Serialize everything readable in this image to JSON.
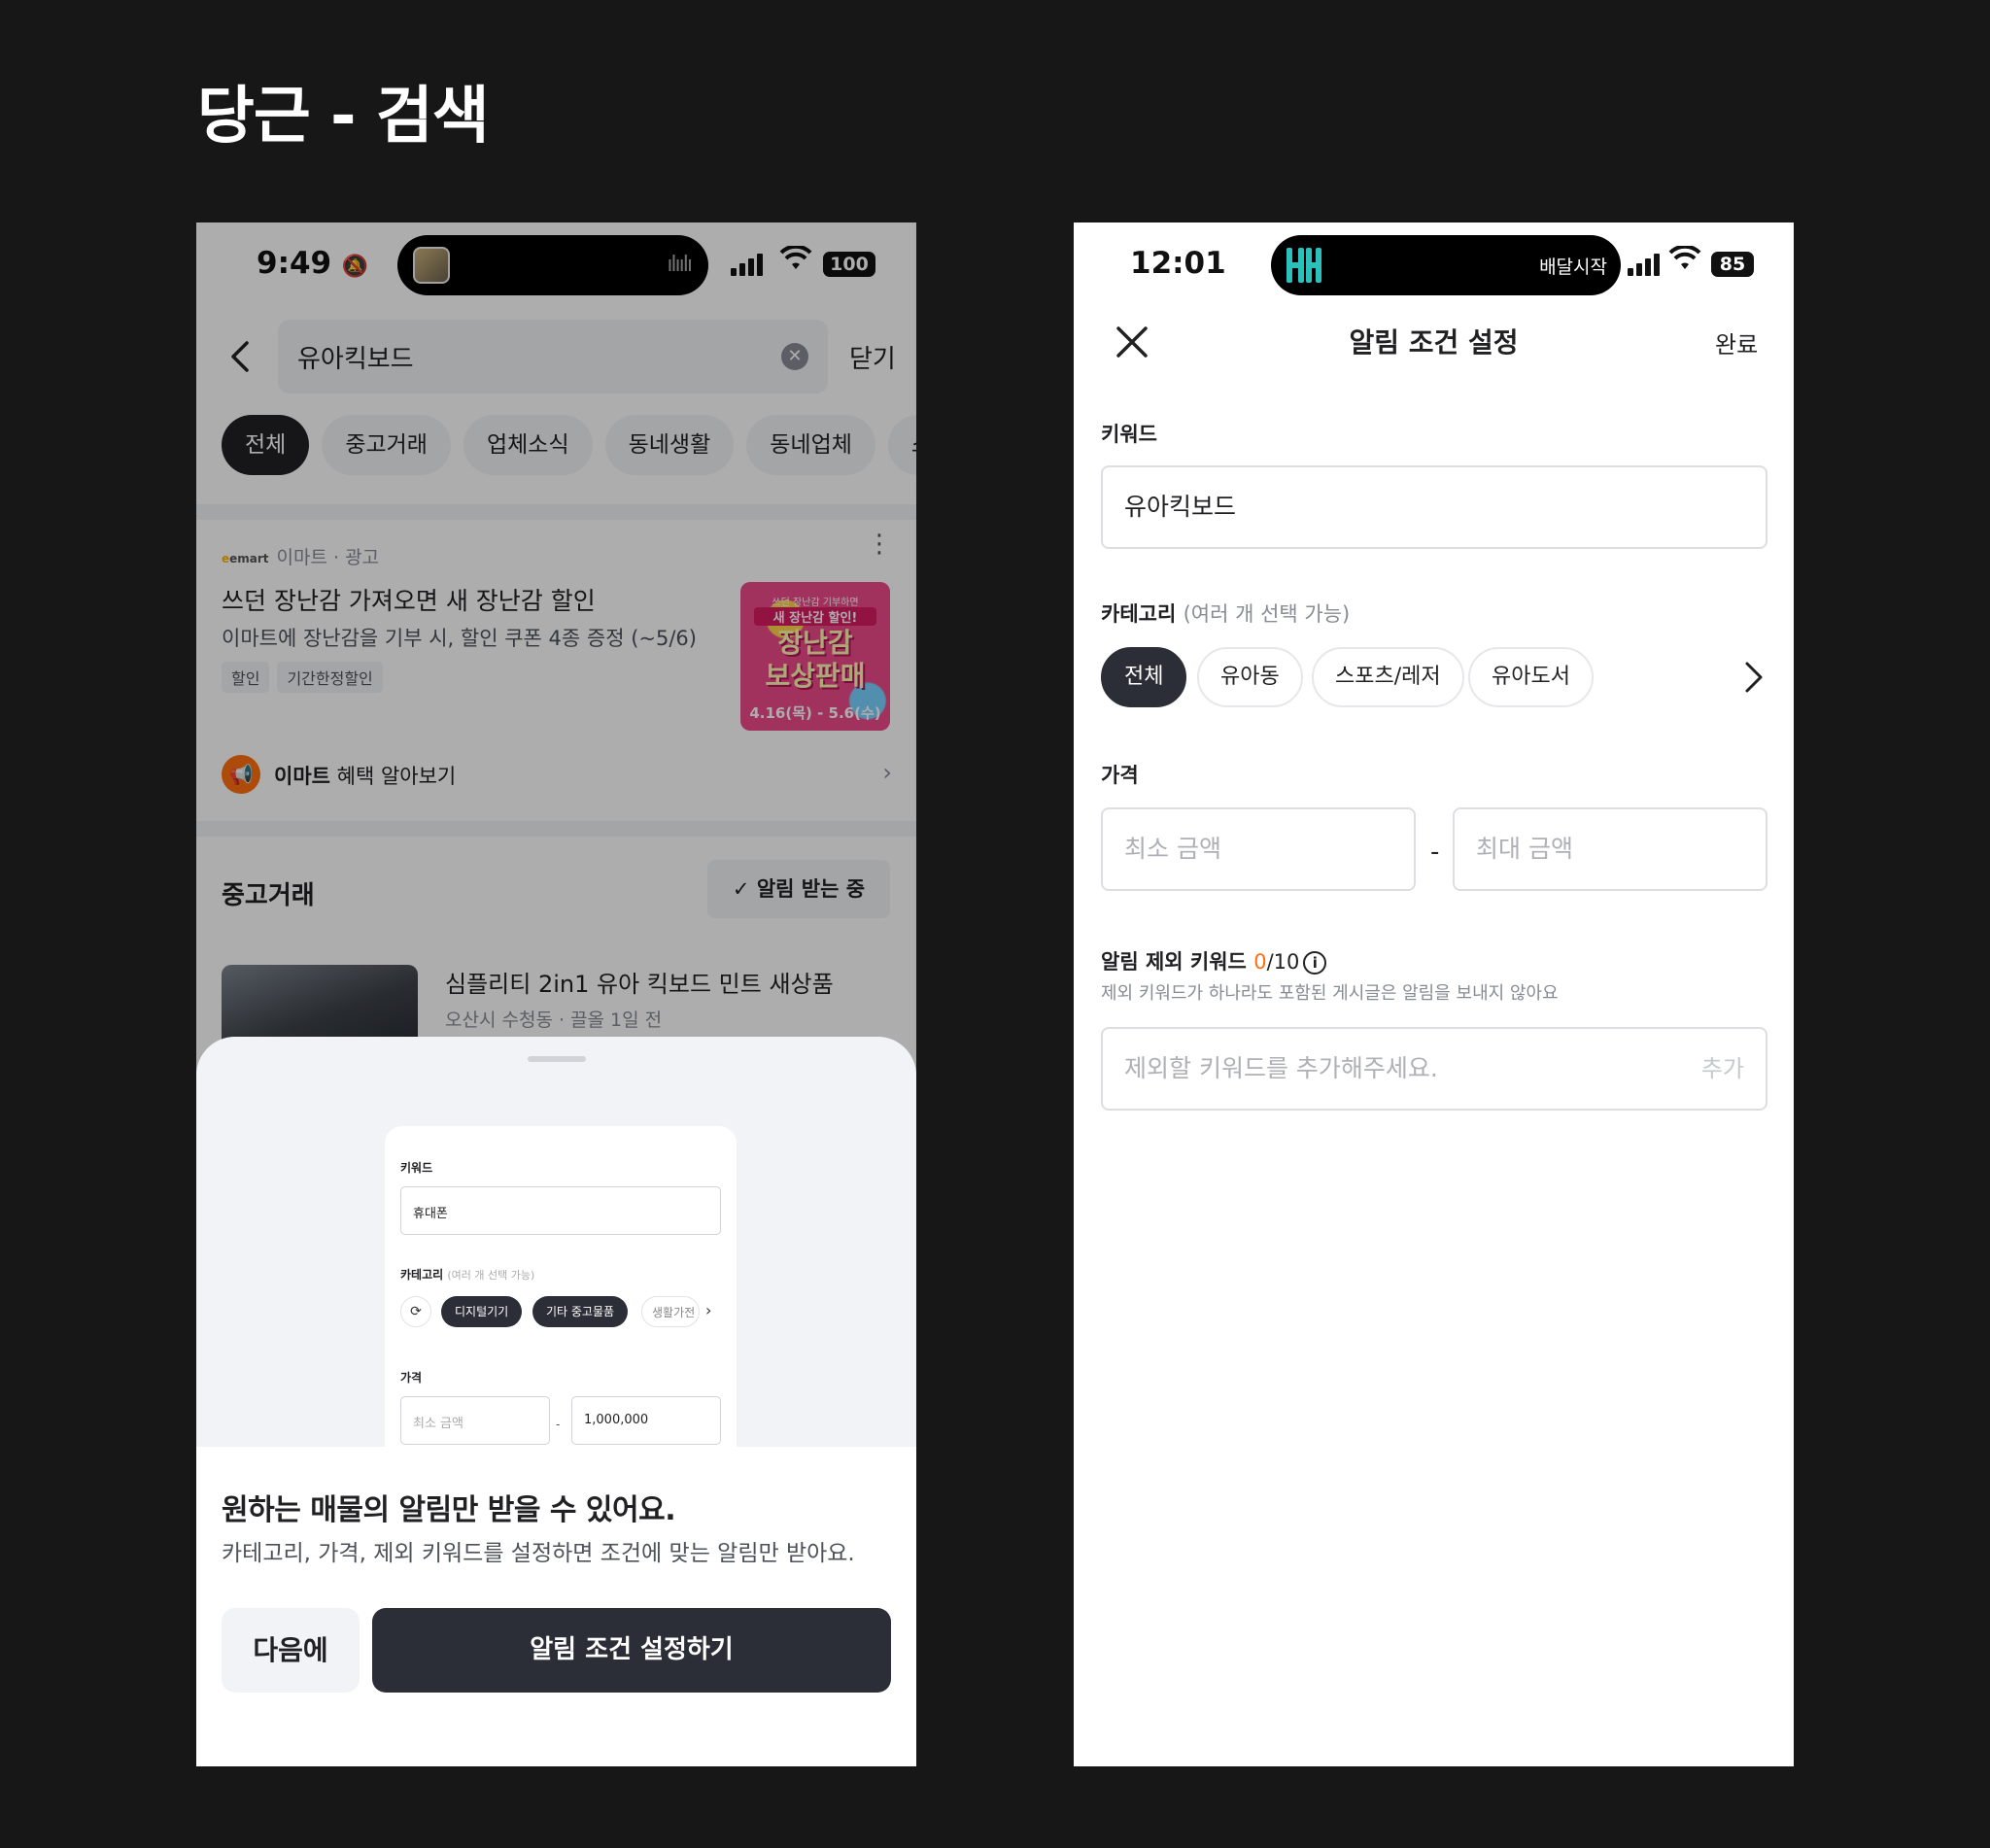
{
  "page_title": "당근 - 검색",
  "left_phone": {
    "status": {
      "time": "9:49",
      "bell_muted": "🔕",
      "battery": "100"
    },
    "search": {
      "query": "유아킥보드",
      "close_label": "닫기"
    },
    "tabs": [
      {
        "label": "전체",
        "active": true
      },
      {
        "label": "중고거래"
      },
      {
        "label": "업체소식"
      },
      {
        "label": "동네생활"
      },
      {
        "label": "동네업체"
      },
      {
        "label": "스토"
      }
    ],
    "ad": {
      "logo": "emart",
      "meta": "이마트 · 광고",
      "title": "쓰던 장난감 가져오면 새 장난감 할인",
      "desc": "이마트에 장난감을 기부 시, 할인 쿠폰 4종 증정 (~5/6)",
      "tags": [
        "할인",
        "기간한정할인"
      ],
      "image_text": {
        "line1": "쓰던 장난감 기부하면",
        "line2": "새 장난감 할인!",
        "big1": "장난감",
        "big2": "보상판매",
        "date": "4.16(목) - 5.6(수)"
      },
      "benefit_brand": "이마트",
      "benefit_text": " 혜택 알아보기"
    },
    "section": {
      "title": "중고거래",
      "alert_label": "✓ 알림 받는 중"
    },
    "item": {
      "title": "심플리티 2in1 유아 킥보드 민트 새상품",
      "meta": "오산시 수청동 · 끌올 1일 전"
    },
    "sheet": {
      "preview": {
        "keyword_label": "키워드",
        "keyword_value": "휴대폰",
        "category_label": "카테고리",
        "category_hint": "(여러 개 선택 가능)",
        "chips": [
          "디지털기기",
          "기타 중고물품",
          "생활가전"
        ],
        "price_label": "가격",
        "min_placeholder": "최소 금액",
        "max_value": "1,000,000"
      },
      "title": "원하는 매물의 알림만 받을 수 있어요.",
      "subtitle": "카테고리, 가격, 제외 키워드를 설정하면 조건에 맞는 알림만 받아요.",
      "later_label": "다음에",
      "setup_label": "알림 조건 설정하기"
    }
  },
  "right_phone": {
    "status": {
      "time": "12:01",
      "island_text": "배달시작",
      "island_logo": "배민",
      "battery": "85"
    },
    "nav": {
      "title": "알림 조건 설정",
      "done_label": "완료"
    },
    "keyword": {
      "label": "키워드",
      "value": "유아킥보드"
    },
    "category": {
      "label": "카테고리",
      "hint": "(여러 개 선택 가능)",
      "chips": [
        {
          "label": "전체",
          "active": true
        },
        {
          "label": "유아동"
        },
        {
          "label": "스포츠/레저"
        },
        {
          "label": "유아도서"
        }
      ]
    },
    "price": {
      "label": "가격",
      "min_placeholder": "최소 금액",
      "max_placeholder": "최대 금액",
      "separator": "-"
    },
    "exclude": {
      "label": "알림 제외 키워드",
      "count": "0",
      "max": "/10",
      "help": "제외 키워드가 하나라도 포함된 게시글은 알림을 보내지 않아요",
      "placeholder": "제외할 키워드를 추가해주세요.",
      "add_label": "추가"
    }
  },
  "colors": {
    "background": "#171717",
    "accent": "#ff6f0f",
    "primary_button": "#2b2e36",
    "chip_bg": "#f2f3f6"
  }
}
